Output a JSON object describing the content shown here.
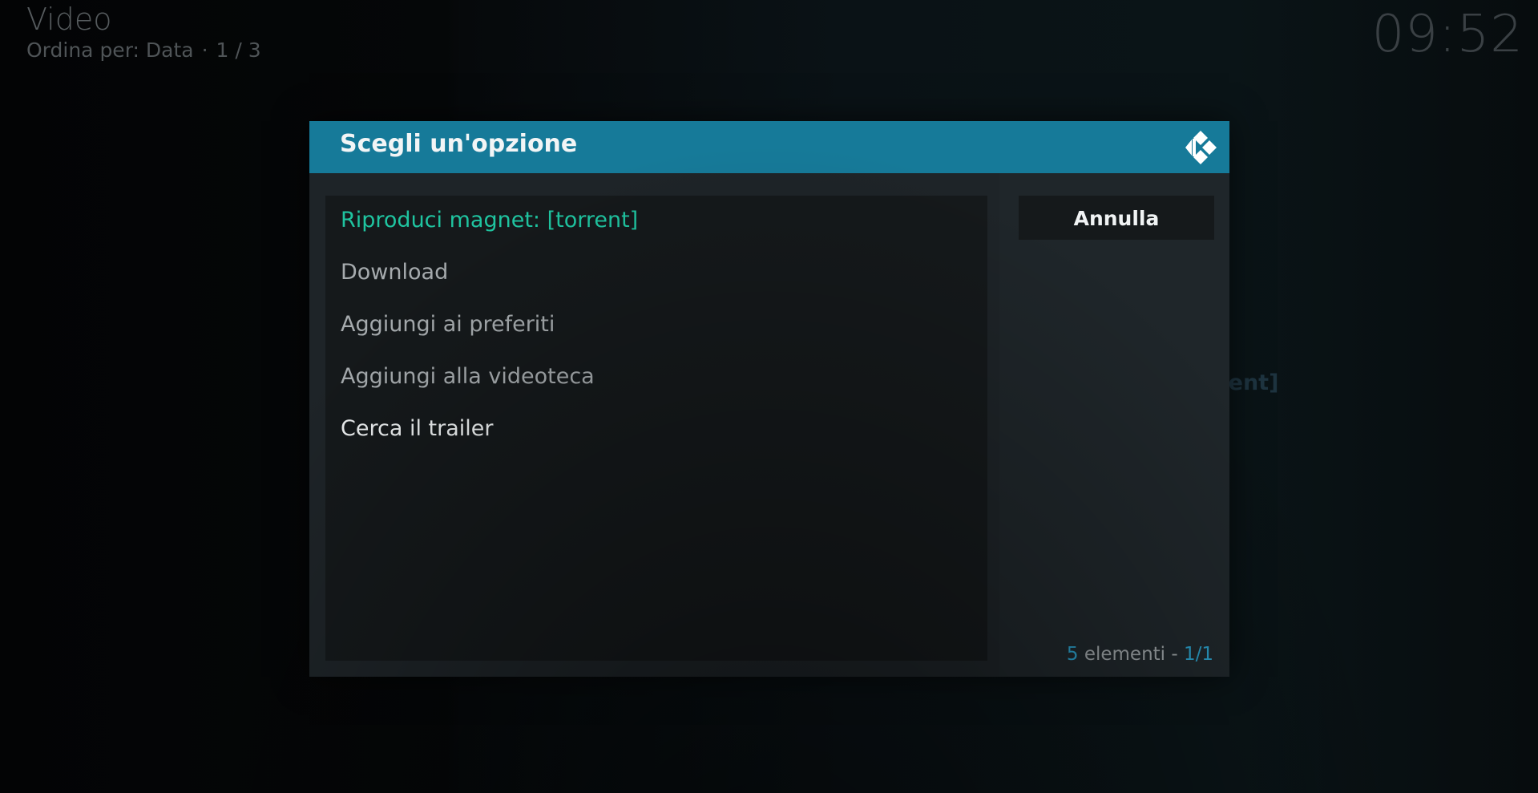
{
  "background": {
    "title": "Video",
    "sort_label": "Ordina per: Data",
    "separator": "·",
    "page": "1 / 3",
    "clock": "09:52",
    "faded_item": "rrent]"
  },
  "dialog": {
    "title": "Scegli un'opzione",
    "logo_icon": "kodi-logo-icon",
    "items": [
      {
        "label": "Riproduci magnet: [torrent]",
        "state": "focused"
      },
      {
        "label": "Download",
        "state": "normal"
      },
      {
        "label": "Aggiungi ai preferiti",
        "state": "normal"
      },
      {
        "label": "Aggiungi alla videoteca",
        "state": "normal"
      },
      {
        "label": "Cerca il trailer",
        "state": "bright"
      }
    ],
    "cancel_label": "Annulla",
    "count": {
      "number": "5",
      "text": " elementi - ",
      "page": "1/1"
    }
  },
  "colors": {
    "header": "#167a99",
    "focused_text": "#1fc4a0",
    "accent": "#2a9bc4"
  }
}
